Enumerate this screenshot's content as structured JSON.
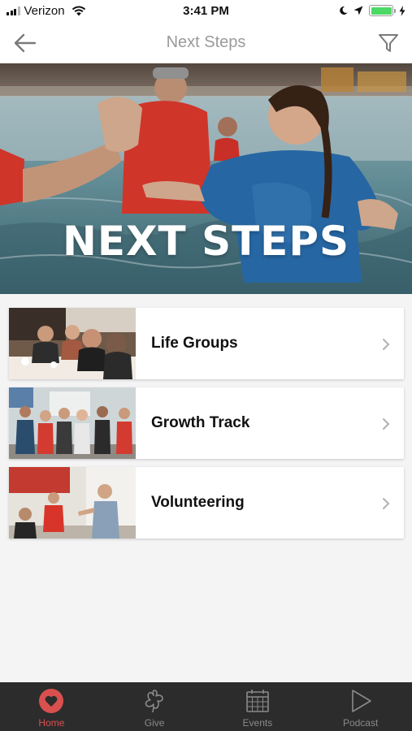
{
  "status_bar": {
    "carrier": "Verizon",
    "time": "3:41 PM"
  },
  "nav": {
    "title": "Next Steps"
  },
  "hero": {
    "title": "NEXT STEPS"
  },
  "cards": [
    {
      "label": "Life Groups"
    },
    {
      "label": "Growth Track"
    },
    {
      "label": "Volunteering"
    }
  ],
  "tabs": [
    {
      "label": "Home",
      "icon": "heart-icon",
      "active": true
    },
    {
      "label": "Give",
      "icon": "give-icon",
      "active": false
    },
    {
      "label": "Events",
      "icon": "calendar-icon",
      "active": false
    },
    {
      "label": "Podcast",
      "icon": "play-icon",
      "active": false
    }
  ],
  "colors": {
    "accent": "#d9504f",
    "tab_bar": "#2c2c2c",
    "battery": "#4cd964"
  }
}
